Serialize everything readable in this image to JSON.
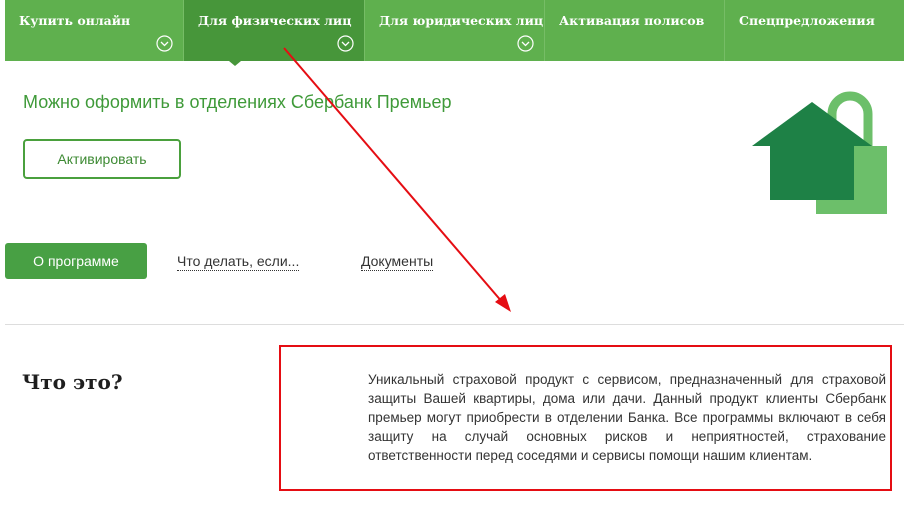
{
  "nav": {
    "items": [
      {
        "label": "Купить онлайн",
        "has_dropdown": true
      },
      {
        "label": "Для физических лиц",
        "has_dropdown": true,
        "active": true
      },
      {
        "label": "Для юридических лиц",
        "has_dropdown": true
      },
      {
        "label": "Активация полисов",
        "has_dropdown": false
      },
      {
        "label": "Спецпредложения",
        "has_dropdown": false
      }
    ]
  },
  "promo": {
    "text": "Можно оформить в отделениях Сбербанк Премьер",
    "activate_label": "Активировать"
  },
  "tabs": {
    "about": "О программе",
    "what_to_do": "Что делать, если...",
    "documents": "Документы"
  },
  "section": {
    "title": "Что это?",
    "description": "Уникальный страховой продукт с сервисом, предназначенный для страховой защиты Вашей квартиры, дома или дачи. Данный продукт клиенты Сбербанк премьер могут приобрести в отделении Банка. Все программы включают в себя защиту на случай основных рисков и неприятностей, страхование ответственности перед соседями и сервисы помощи нашим клиентам."
  },
  "colors": {
    "nav_bg": "#5fb04e",
    "nav_active": "#47963a",
    "accent_green": "#48a044",
    "annotation_red": "#e50d13"
  },
  "icons": {
    "dropdown": "chevron-down-circle-icon",
    "logo": "house-lock-icon"
  }
}
